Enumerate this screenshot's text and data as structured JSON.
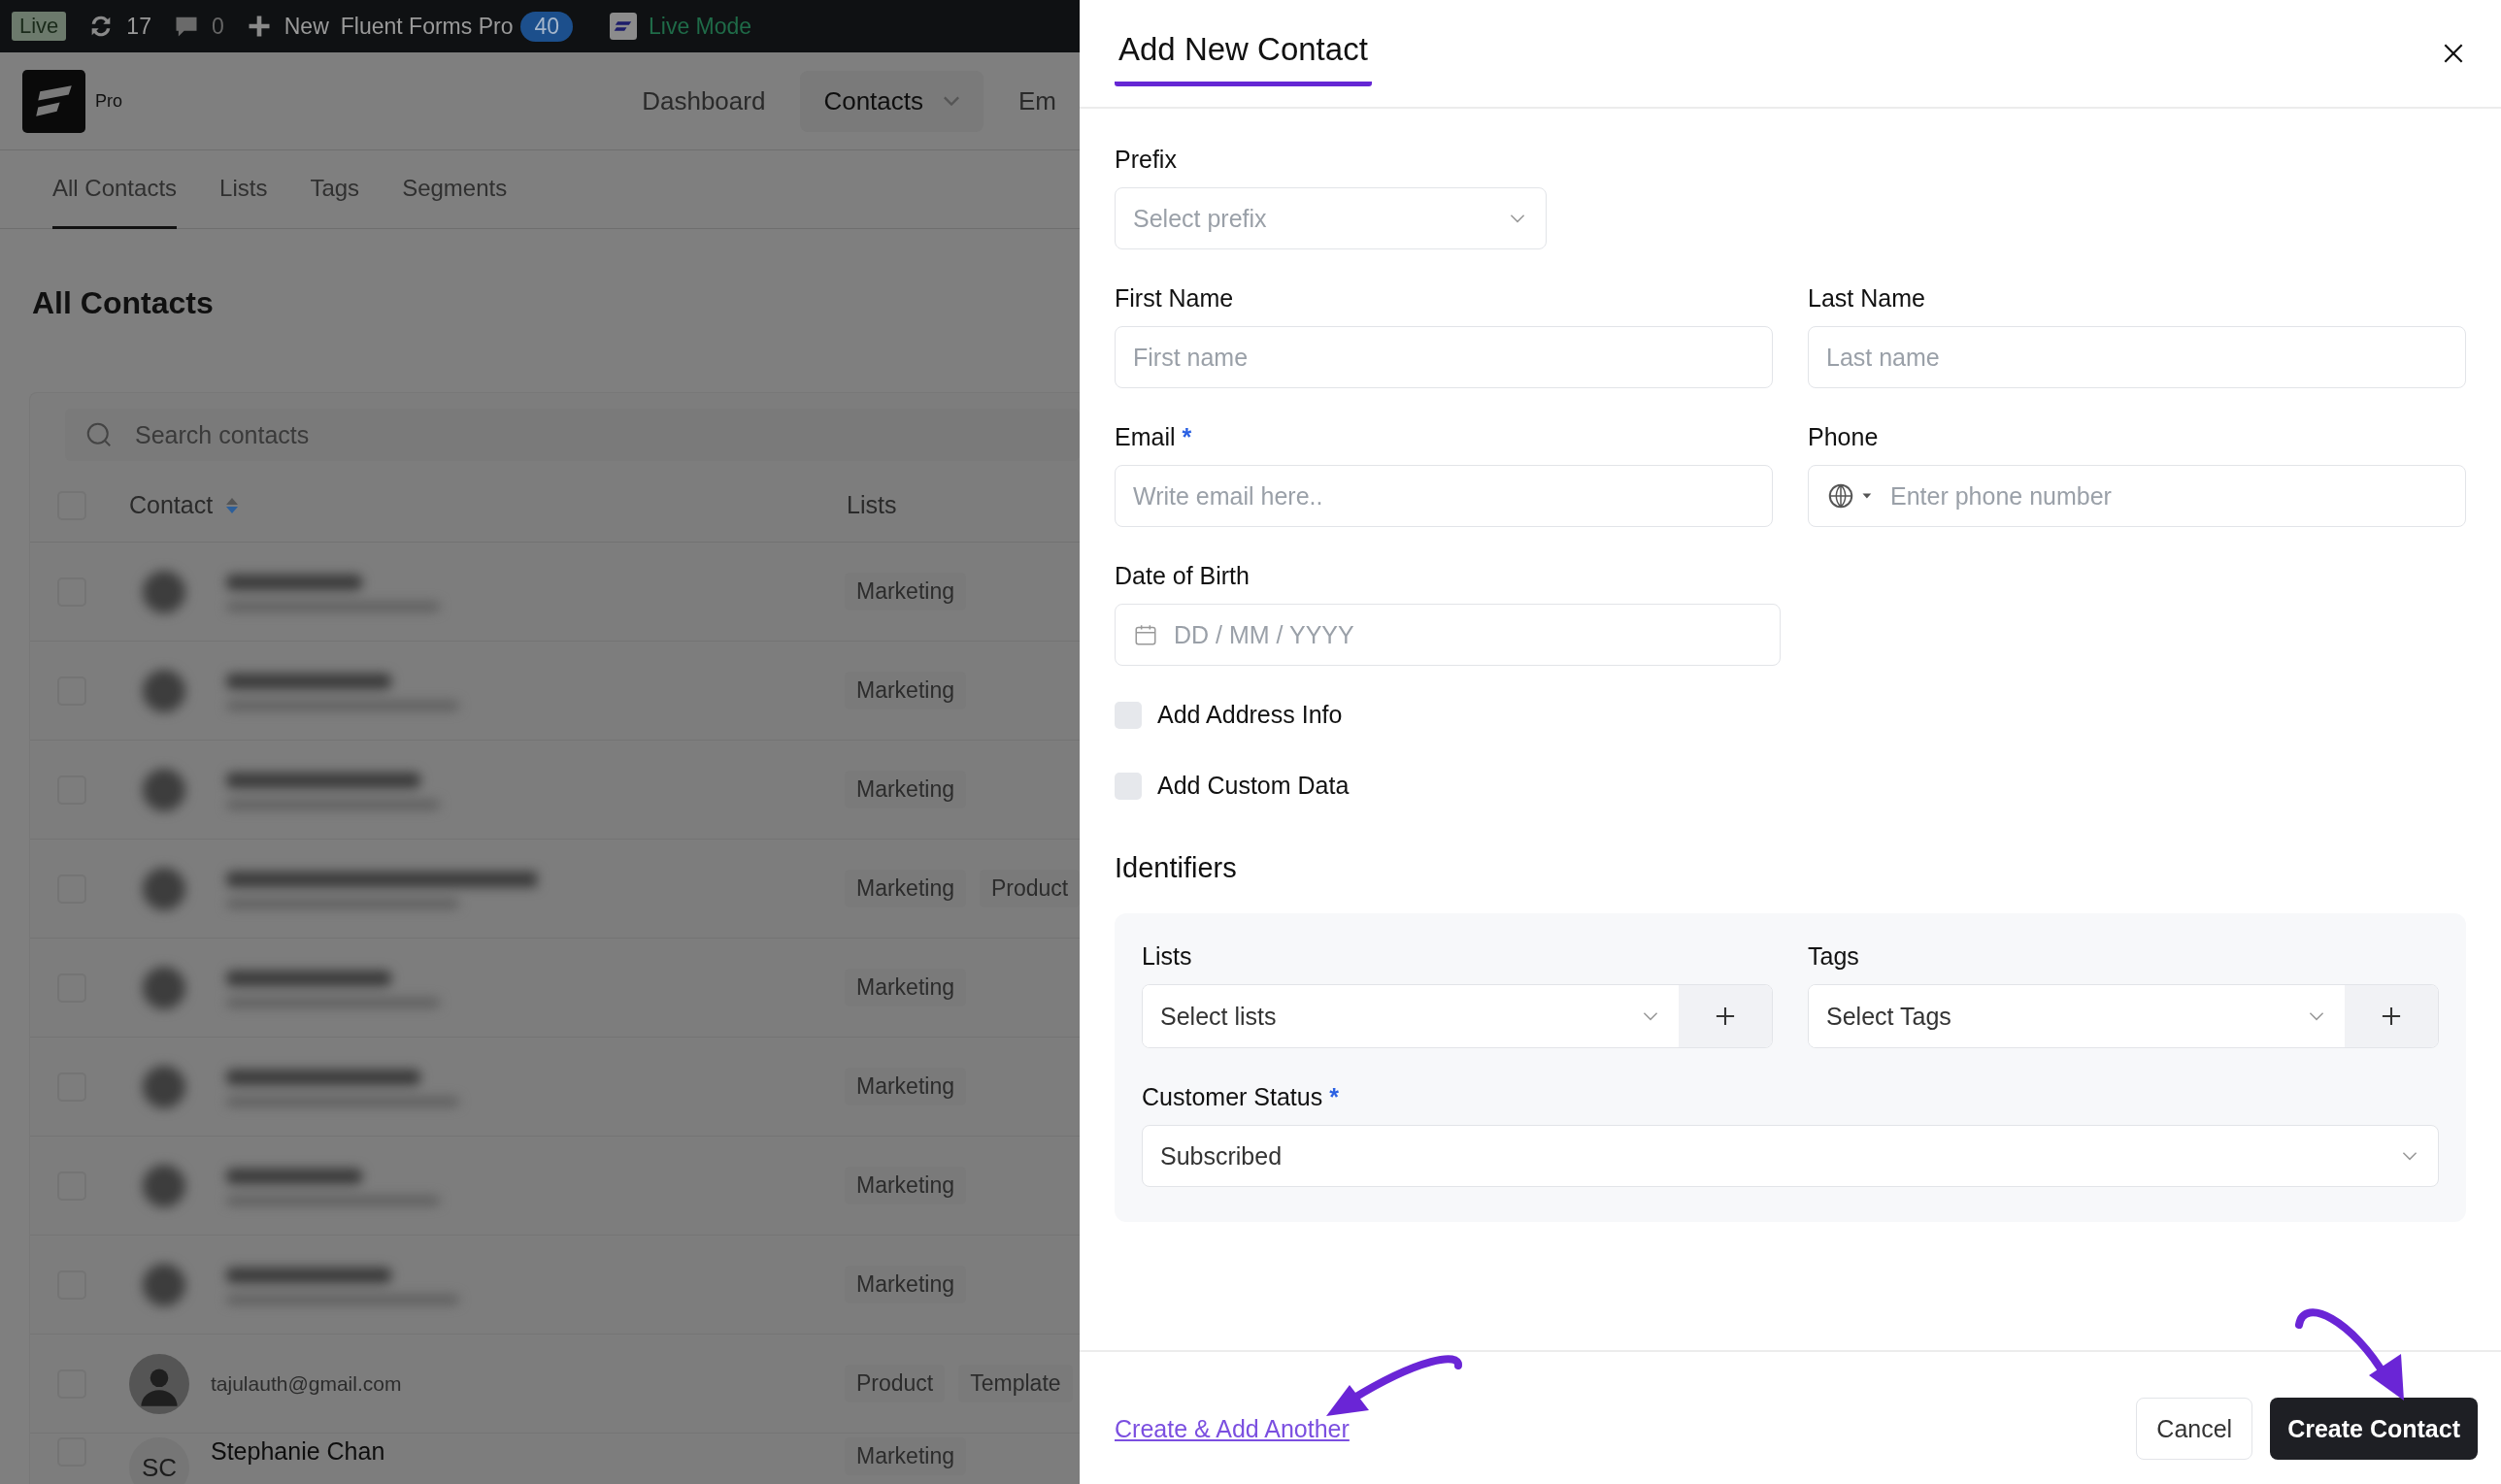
{
  "admin_bar": {
    "live_badge": "Live",
    "updates": "17",
    "comments": "0",
    "new": "New",
    "plugin": "Fluent Forms Pro",
    "plugin_count": "40",
    "mode": "Live Mode"
  },
  "app_header": {
    "logo_label": "Pro",
    "nav": [
      {
        "label": "Dashboard",
        "selected": false
      },
      {
        "label": "Contacts",
        "selected": true
      },
      {
        "label": "Em",
        "selected": false
      }
    ]
  },
  "subtabs": [
    {
      "label": "All Contacts",
      "selected": true
    },
    {
      "label": "Lists",
      "selected": false
    },
    {
      "label": "Tags",
      "selected": false
    },
    {
      "label": "Segments",
      "selected": false
    }
  ],
  "page_title": "All Contacts",
  "search": {
    "placeholder": "Search contacts"
  },
  "table": {
    "columns": [
      "Contact",
      "Lists"
    ],
    "all_checked": false,
    "rows": [
      {
        "kind": "blurred",
        "checked": false,
        "lists": [
          "Marketing"
        ]
      },
      {
        "kind": "blurred",
        "checked": false,
        "lists": [
          "Marketing"
        ]
      },
      {
        "kind": "blurred",
        "checked": false,
        "lists": [
          "Marketing"
        ]
      },
      {
        "kind": "blurred",
        "checked": false,
        "lists": [
          "Marketing",
          "Product"
        ]
      },
      {
        "kind": "blurred",
        "checked": false,
        "lists": [
          "Marketing"
        ]
      },
      {
        "kind": "blurred",
        "checked": false,
        "lists": [
          "Marketing"
        ]
      },
      {
        "kind": "blurred",
        "checked": false,
        "lists": [
          "Marketing"
        ]
      },
      {
        "kind": "blurred",
        "checked": false,
        "lists": [
          "Marketing"
        ]
      },
      {
        "kind": "photo",
        "checked": false,
        "email": "tajulauth@gmail.com",
        "lists": [
          "Product",
          "Template"
        ]
      },
      {
        "kind": "initials",
        "checked": false,
        "initials": "SC",
        "name": "Stephanie Chan",
        "lists": [
          "Marketing"
        ]
      }
    ]
  },
  "drawer": {
    "title": "Add New Contact",
    "prefix": {
      "label": "Prefix",
      "placeholder": "Select prefix"
    },
    "first_name": {
      "label": "First Name",
      "placeholder": "First name"
    },
    "last_name": {
      "label": "Last Name",
      "placeholder": "Last name"
    },
    "email": {
      "label": "Email",
      "required": true,
      "required_mark": "*",
      "placeholder": "Write email here.."
    },
    "phone": {
      "label": "Phone",
      "placeholder": "Enter phone number"
    },
    "dob": {
      "label": "Date of Birth",
      "placeholder": "DD / MM / YYYY"
    },
    "checkboxes": [
      {
        "label": "Add Address Info",
        "checked": false
      },
      {
        "label": "Add Custom Data",
        "checked": false
      }
    ],
    "identifiers": {
      "title": "Identifiers",
      "lists": {
        "label": "Lists",
        "placeholder": "Select lists"
      },
      "tags": {
        "label": "Tags",
        "placeholder": "Select Tags"
      },
      "status": {
        "label": "Customer Status",
        "required": true,
        "required_mark": "*",
        "value": "Subscribed"
      }
    },
    "footer": {
      "link": "Create & Add Another",
      "cancel": "Cancel",
      "submit": "Create Contact"
    }
  }
}
